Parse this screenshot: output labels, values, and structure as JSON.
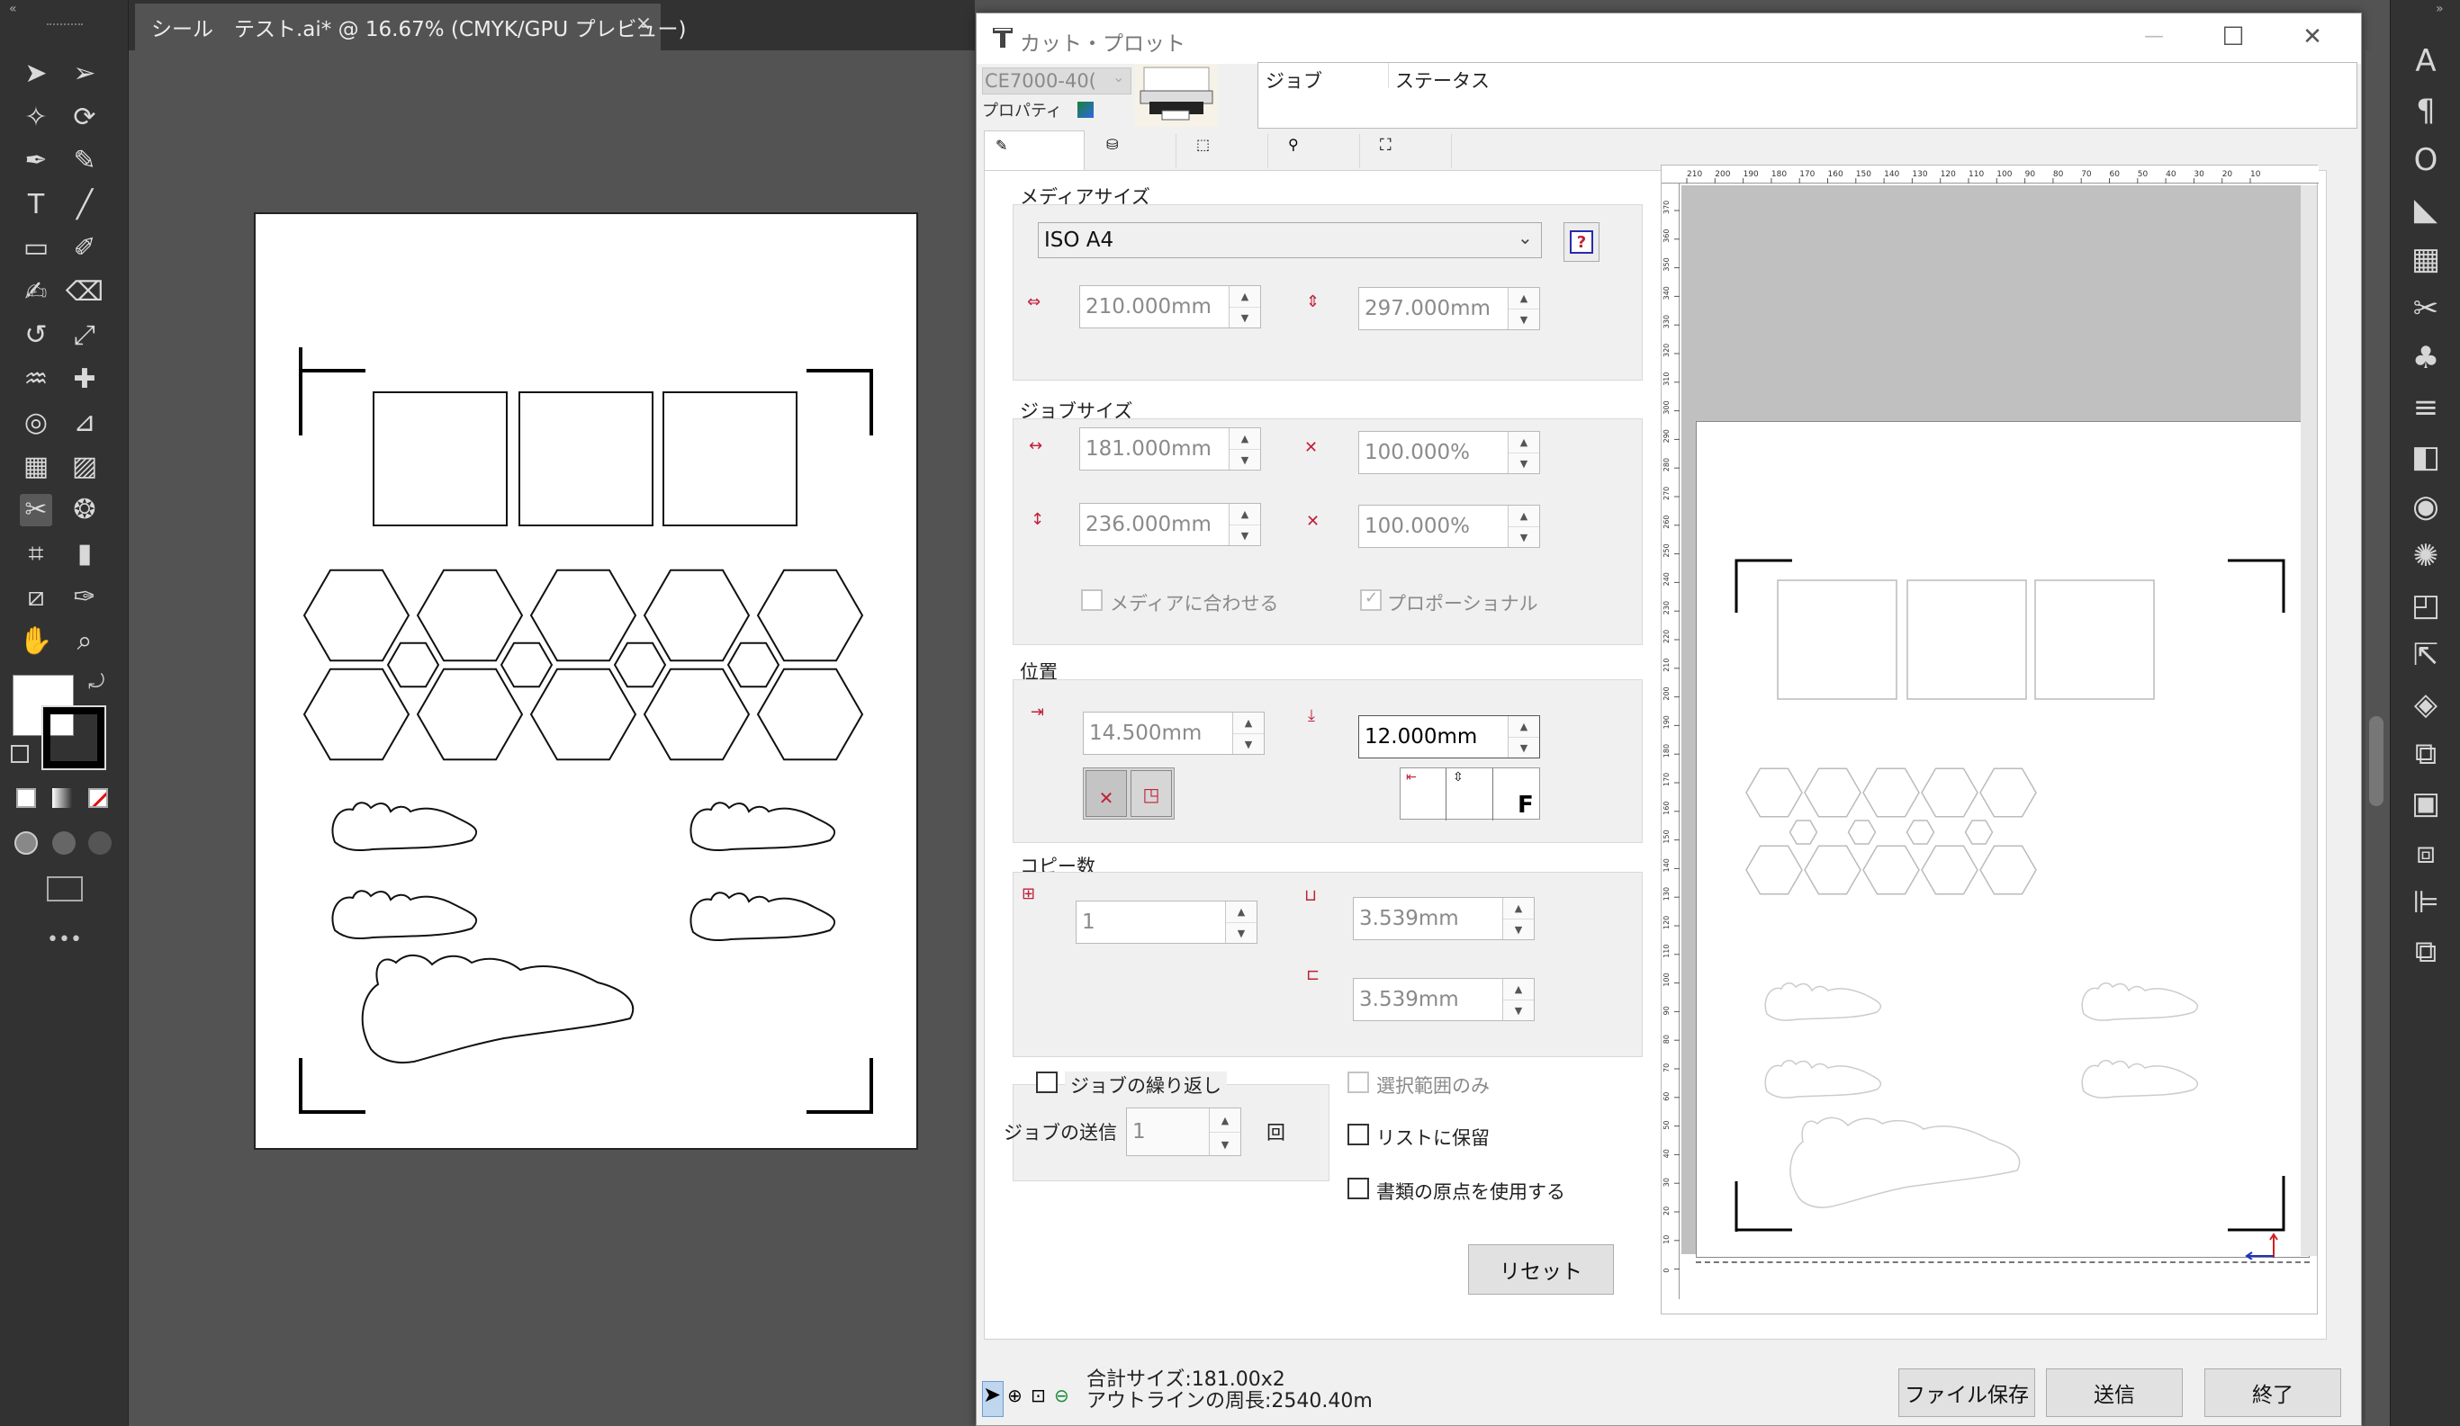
{
  "document": {
    "tab_title": "シール　テスト.ai* @ 16.67% (CMYK/GPU プレビュー)",
    "tab_close": "×"
  },
  "toolbar": {
    "more_label": "•••",
    "tools": [
      "selection-icon",
      "direct-selection-icon",
      "magic-wand-icon",
      "lasso-icon",
      "pen-icon",
      "curvature-icon",
      "type-icon",
      "line-icon",
      "rectangle-icon",
      "paintbrush-icon",
      "shaper-icon",
      "eraser-icon",
      "rotate-icon",
      "scale-icon",
      "warp-icon",
      "puppet-warp-icon",
      "shape-builder-icon",
      "perspective-icon",
      "mesh-icon",
      "gradient-icon",
      "cutting-plugin-icon",
      "symbol-sprayer-icon",
      "artboard-icon",
      "graph-icon",
      "slice-icon",
      "eyedropper-icon",
      "hand-icon",
      "zoom-icon"
    ]
  },
  "dock": {
    "icons": [
      "character-icon",
      "paragraph-icon",
      "opentype-icon",
      "gradient-panel-icon",
      "swatches-icon",
      "brushes-icon",
      "symbols-icon",
      "stroke-icon",
      "transparency-icon",
      "appearance-icon",
      "graphic-styles-icon",
      "image-trace-icon",
      "export-icon",
      "layers-icon",
      "artboards-icon",
      "asset-icon",
      "transform-icon",
      "align-icon",
      "pathfinder-icon"
    ]
  },
  "dialog": {
    "title": "カット・プロット",
    "controls": {
      "minimize": "—",
      "maximize": "☐",
      "close": "✕"
    },
    "device_name": "CE7000-40(",
    "properties_label": "プロパティ",
    "job_header": "ジョブ",
    "status_header": "ステータス",
    "tabs": [
      "tab-general",
      "tab-cutting-condition",
      "tab-tiling",
      "tab-register-mark",
      "tab-other"
    ],
    "media": {
      "section": "メディアサイズ",
      "size_select": "ISO A4",
      "width": "210.000mm",
      "height": "297.000mm"
    },
    "job_size": {
      "section": "ジョブサイズ",
      "width": "181.000mm",
      "height": "236.000mm",
      "scale_x": "100.000%",
      "scale_y": "100.000%",
      "fit_to_media": "メディアに合わせる",
      "proportional": "プロポーショナル"
    },
    "position": {
      "section": "位置",
      "x": "14.500mm",
      "y": "12.000mm"
    },
    "copies": {
      "section": "コピー数",
      "count": "1",
      "gap_x": "3.539mm",
      "gap_y": "3.539mm"
    },
    "options": {
      "repeat_job": "ジョブの繰り返し",
      "send_job": "ジョブの送信",
      "send_count": "1",
      "times": "回",
      "selection_only": "選択範囲のみ",
      "keep_in_list": "リストに保留",
      "use_document_origin": "書類の原点を使用する"
    },
    "reset": "リセット",
    "footer": {
      "total_size": "合計サイズ:181.00x2",
      "line_length": "アウトラインの周長:2540.40m"
    },
    "buttons": {
      "save_file": "ファイル保存",
      "send": "送信",
      "finish": "終了"
    },
    "ruler_top": [
      "210",
      "200",
      "190",
      "180",
      "170",
      "160",
      "150",
      "140",
      "130",
      "120",
      "110",
      "100",
      "90",
      "80",
      "70",
      "60",
      "50",
      "40",
      "30",
      "20",
      "10"
    ],
    "ruler_left": [
      "370",
      "360",
      "350",
      "340",
      "330",
      "320",
      "310",
      "300",
      "290",
      "280",
      "270",
      "260",
      "250",
      "240",
      "230",
      "220",
      "210",
      "200",
      "190",
      "180",
      "170",
      "160",
      "150",
      "140",
      "130",
      "120",
      "110",
      "100",
      "90",
      "80",
      "70",
      "60",
      "50",
      "40",
      "30",
      "20",
      "10",
      "0"
    ]
  }
}
